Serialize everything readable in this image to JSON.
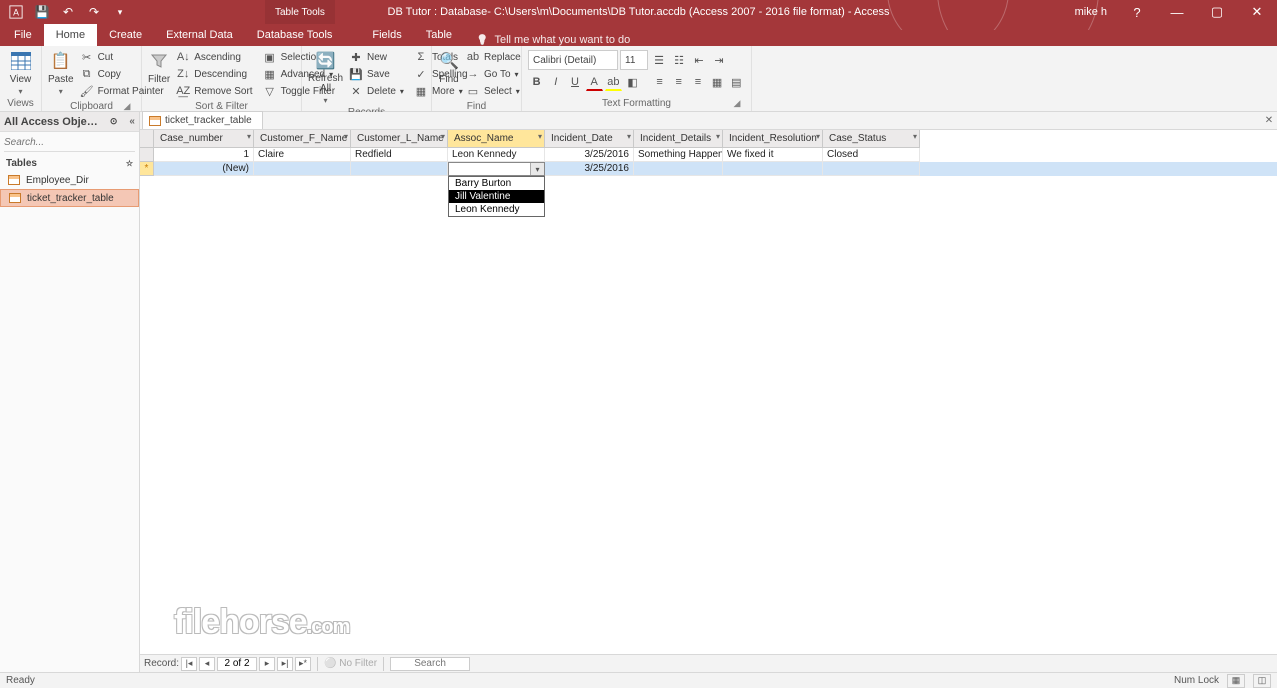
{
  "titlebar": {
    "tabletools": "Table Tools",
    "title": "DB Tutor : Database- C:\\Users\\m\\Documents\\DB Tutor.accdb (Access 2007 - 2016 file format) - Access",
    "user": "mike h"
  },
  "tabs": {
    "file": "File",
    "home": "Home",
    "create": "Create",
    "externaldata": "External Data",
    "dbtools": "Database Tools",
    "fields": "Fields",
    "table": "Table",
    "tellme": "Tell me what you want to do"
  },
  "ribbon": {
    "views": {
      "view": "View",
      "group": "Views"
    },
    "clipboard": {
      "paste": "Paste",
      "cut": "Cut",
      "copy": "Copy",
      "fp": "Format Painter",
      "group": "Clipboard"
    },
    "sortfilter": {
      "filter": "Filter",
      "asc": "Ascending",
      "desc": "Descending",
      "rem": "Remove Sort",
      "sel": "Selection",
      "adv": "Advanced",
      "tog": "Toggle Filter",
      "group": "Sort & Filter"
    },
    "records": {
      "refresh": "Refresh\nAll",
      "new": "New",
      "save": "Save",
      "del": "Delete",
      "totals": "Totals",
      "spell": "Spelling",
      "more": "More",
      "group": "Records"
    },
    "find": {
      "find": "Find",
      "replace": "Replace",
      "goto": "Go To",
      "select": "Select",
      "group": "Find"
    },
    "textfmt": {
      "font": "Calibri (Detail)",
      "size": "11",
      "group": "Text Formatting"
    }
  },
  "nav": {
    "header": "All Access Obje…",
    "search_ph": "Search...",
    "section": "Tables",
    "items": [
      "Employee_Dir",
      "ticket_tracker_table"
    ]
  },
  "doc": {
    "tab": "ticket_tracker_table",
    "cols": [
      "Case_number",
      "Customer_F_Name",
      "Customer_L_Name",
      "Assoc_Name",
      "Incident_Date",
      "Incident_Details",
      "Incident_Resolution",
      "Case_Status"
    ],
    "widths": [
      100,
      97,
      97,
      97,
      89,
      89,
      100,
      97
    ],
    "row1": {
      "case": "1",
      "cf": "Claire",
      "cl": "Redfield",
      "assoc": "Leon Kennedy",
      "date": "3/25/2016",
      "det": "Something Happene",
      "res": "We fixed it",
      "status": "Closed"
    },
    "newrow": {
      "label": "(New)",
      "date": "3/25/2016"
    },
    "dropdown": [
      "Barry Burton",
      "Jill Valentine",
      "Leon Kennedy"
    ]
  },
  "recnav": {
    "label": "Record:",
    "pos": "2 of 2",
    "nofilter": "No Filter",
    "search": "Search"
  },
  "status": {
    "ready": "Ready",
    "numlock": "Num Lock"
  },
  "watermark": {
    "a": "filehorse",
    "b": ".com"
  }
}
